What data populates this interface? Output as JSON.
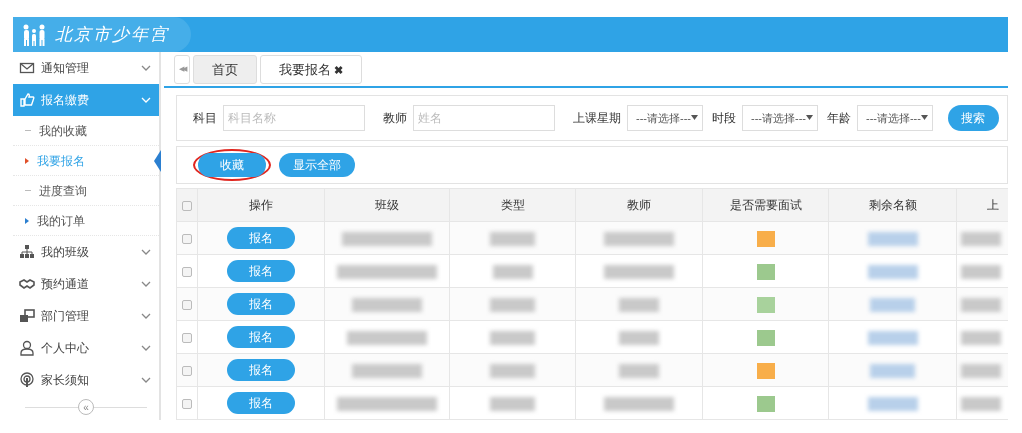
{
  "logo": {
    "title": "北京市少年宫"
  },
  "sidebar": {
    "items": [
      {
        "label": "通知管理",
        "selected": false
      },
      {
        "label": "报名缴费",
        "selected": true,
        "children": [
          {
            "label": "我的收藏",
            "selected": false,
            "expandable": false
          },
          {
            "label": "我要报名",
            "selected": true,
            "expandable": true
          },
          {
            "label": "进度查询",
            "selected": false,
            "expandable": false
          },
          {
            "label": "我的订单",
            "selected": false,
            "expandable": true
          }
        ]
      },
      {
        "label": "我的班级",
        "selected": false
      },
      {
        "label": "预约通道",
        "selected": false
      },
      {
        "label": "部门管理",
        "selected": false
      },
      {
        "label": "个人中心",
        "selected": false
      },
      {
        "label": "家长须知",
        "selected": false
      }
    ],
    "collapse": "«"
  },
  "tabs": {
    "scroll_button": "◀◀",
    "items": [
      {
        "label": "首页",
        "selected": false
      },
      {
        "label": "我要报名",
        "selected": true,
        "close": "✖"
      }
    ]
  },
  "filters": [
    {
      "kind": "input",
      "label": "科目",
      "placeholder": "科目名称"
    },
    {
      "kind": "input",
      "label": "教师",
      "placeholder": "姓名"
    },
    {
      "kind": "select",
      "label": "上课星期",
      "value": "---请选择---"
    },
    {
      "kind": "select",
      "label": "时段",
      "value": "---请选择---"
    },
    {
      "kind": "select",
      "label": "年龄",
      "value": "---请选择---"
    }
  ],
  "search_button": "搜索",
  "actions": [
    {
      "label": "收藏",
      "highlighted": true
    },
    {
      "label": "显示全部",
      "highlighted": false
    }
  ],
  "table": {
    "select_all_checked": false,
    "columns": [
      "操作",
      "班级",
      "类型",
      "教师",
      "是否需要面试",
      "剩余名额",
      "上"
    ],
    "rows": [
      {
        "checked": false,
        "action": "报名",
        "color": "#f8ae4a"
      },
      {
        "checked": false,
        "action": "报名",
        "color": "#9cc98e"
      },
      {
        "checked": false,
        "action": "报名",
        "color": "#a8d29c"
      },
      {
        "checked": false,
        "action": "报名",
        "color": "#9cc98e"
      },
      {
        "checked": false,
        "action": "报名",
        "color": "#f8ae4a"
      },
      {
        "checked": false,
        "action": "报名",
        "color": "#9cc98e"
      }
    ]
  }
}
